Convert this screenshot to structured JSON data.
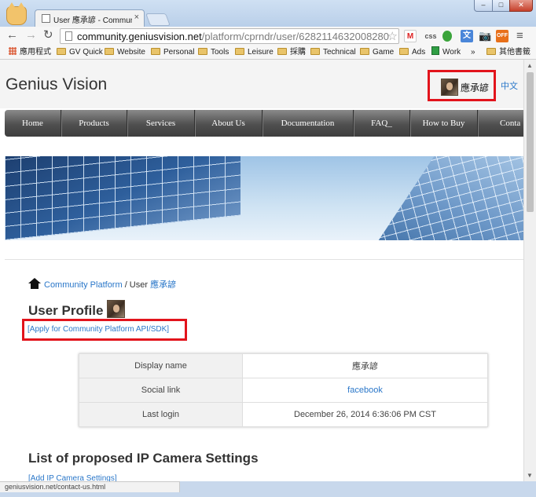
{
  "browser": {
    "tab_title": "User 應承諺 - Community",
    "url_host": "community.geniusvision.net",
    "url_path": "/platform/cprndr/user/6282114632008280",
    "extensions": {
      "gmail": "M",
      "css": "css",
      "translate": "文",
      "camera": "📷",
      "off": "OFF"
    },
    "bookmarks": [
      "應用程式",
      "GV Quick",
      "Website",
      "Personal",
      "Tools",
      "Leisure",
      "採購",
      "Technical",
      "Game",
      "Ads",
      "Work",
      "»",
      "其他書籤"
    ],
    "status_url": "geniusvision.net/contact-us.html"
  },
  "site": {
    "logo": "Genius Vision",
    "user_name": "應承諺",
    "language_link": "中文",
    "nav": [
      "Home",
      "Products",
      "Services",
      "About Us",
      "Documentation",
      "FAQ_",
      "How to Buy",
      "Conta"
    ]
  },
  "breadcrumb": {
    "link": "Community Platform",
    "separator": " / User ",
    "user": "應承諺"
  },
  "profile": {
    "title": "User Profile",
    "apply_link": "[Apply for Community Platform API/SDK]",
    "rows": [
      {
        "label": "Display name",
        "value": "應承諺"
      },
      {
        "label": "Social link",
        "value": "facebook"
      },
      {
        "label": "Last login",
        "value": "December 26, 2014 6:36:06 PM CST"
      }
    ]
  },
  "settings": {
    "title": "List of proposed IP Camera Settings",
    "add_link": "[Add IP Camera Settings]"
  }
}
